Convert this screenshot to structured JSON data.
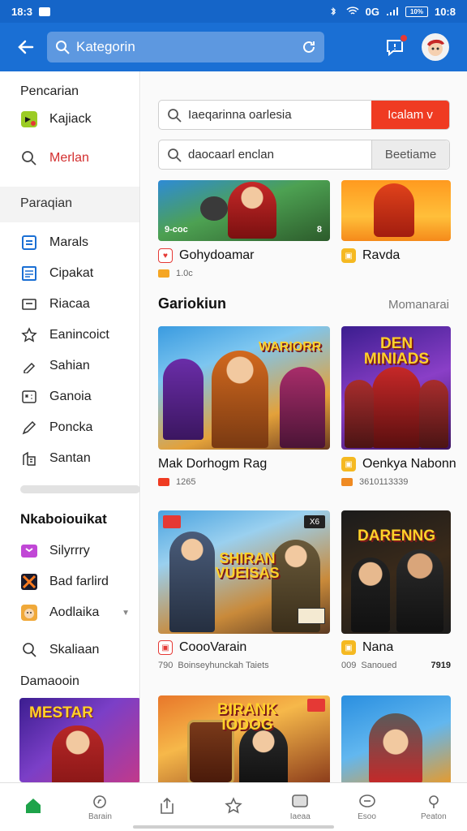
{
  "status_bar": {
    "time": "18:3",
    "network": "0G",
    "battery": "10%",
    "clock_right": "10:8"
  },
  "app_bar": {
    "search_value": "Kategorin"
  },
  "sidebar": {
    "heading": "Pencarian",
    "top_items": [
      {
        "label": "Kajiack",
        "icon": "app-icon"
      },
      {
        "label": "Merlan",
        "icon": "search-icon",
        "color": "#d32f2f"
      }
    ],
    "section_label": "Paraqian",
    "items": [
      {
        "label": "Marals",
        "icon": "grid-icon"
      },
      {
        "label": "Cipakat",
        "icon": "list-icon"
      },
      {
        "label": "Riacaa",
        "icon": "card-icon"
      },
      {
        "label": "Eanincoict",
        "icon": "star-icon"
      },
      {
        "label": "Sahian",
        "icon": "tag-icon"
      },
      {
        "label": "Ganoia",
        "icon": "gamepad-icon"
      },
      {
        "label": "Poncka",
        "icon": "pencil-icon"
      },
      {
        "label": "Santan",
        "icon": "building-icon"
      }
    ],
    "group_title": "Nkaboiouikat",
    "group_items": [
      {
        "label": "Silyrrry",
        "icon": "app-icon"
      },
      {
        "label": "Bad farlird",
        "icon": "app-icon"
      },
      {
        "label": "Aodlaika",
        "icon": "app-icon"
      }
    ],
    "extra_item": "Skaliaan",
    "sub_heading": "Damaooin",
    "banner_text": "MESTAR"
  },
  "main": {
    "filter1": {
      "placeholder": "Iaeqarinna oarlesia",
      "button": "Icalam v"
    },
    "filter2": {
      "placeholder": "daocaarl enclan",
      "button": "Beetiame"
    },
    "top_cards": [
      {
        "title": "Gohydoamar",
        "meta": "1.0c",
        "overlay_left": "9-coc",
        "overlay_right": "8"
      },
      {
        "title": "Ravda"
      }
    ],
    "section_title": "Gariokiun",
    "section_more": "Momanarai",
    "cards": [
      {
        "title": "Mak Dorhogm Rag",
        "meta": "1265",
        "img_text": "WARIORR"
      },
      {
        "title": "Oenkya Nabonn",
        "meta": "3610113339",
        "img_text": "DEN MINIADS"
      },
      {
        "title": "CoooVarain",
        "meta": "Boinseyhunckah Taiets",
        "meta_prefix": "790",
        "img_text": "SHIRAN VUEISAS",
        "tag_left": "■",
        "tag_right": "X6"
      },
      {
        "title": "Nana",
        "meta": "Sanoued",
        "meta_prefix": "009",
        "meta_right": "7919",
        "img_text": "DARENNG"
      },
      {
        "title": "",
        "meta": "",
        "img_text": "BIRANK IODOG"
      },
      {
        "title": "",
        "meta": "",
        "img_text": ""
      }
    ]
  },
  "bottom_nav": [
    {
      "label": "",
      "icon": "home-icon"
    },
    {
      "label": "Barain",
      "icon": "compass-icon"
    },
    {
      "label": "",
      "icon": "share-icon"
    },
    {
      "label": "",
      "icon": "star-icon"
    },
    {
      "label": "Iaeaa",
      "icon": "message-icon"
    },
    {
      "label": "Esoo",
      "icon": "chat-icon"
    },
    {
      "label": "Peaton",
      "icon": "profile-icon"
    }
  ],
  "colors": {
    "primary": "#1a6fd4",
    "accent_red": "#ef3b22",
    "active_green": "#1ea34a"
  }
}
